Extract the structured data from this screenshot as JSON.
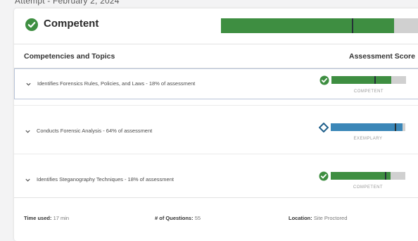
{
  "attempt": {
    "title": "Attempt - February 2, 2024"
  },
  "summary": {
    "status": "Competent",
    "status_color": "#3e8e41",
    "score_fraction": 0.82,
    "marker_fraction": 0.62
  },
  "table": {
    "col_topics": "Competencies and Topics",
    "col_score": "Assessment Score"
  },
  "topics": [
    {
      "label": "Identifies Forensics Rules, Policies, and Laws - 18% of assessment",
      "level": "COMPETENT",
      "icon": "check-circle-icon",
      "color": "#3e8e41",
      "fill": 0.8,
      "marker": 0.58,
      "selected": true
    },
    {
      "label": "Conducts Forensic Analysis - 64% of assessment",
      "level": "EXEMPLARY",
      "icon": "diamond-icon",
      "color": "#3b87b8",
      "fill": 0.96,
      "marker": 0.86,
      "selected": false
    },
    {
      "label": "Identifies Steganography Techniques - 18% of assessment",
      "level": "COMPETENT",
      "icon": "check-circle-icon",
      "color": "#3e8e41",
      "fill": 0.8,
      "marker": 0.73,
      "selected": false
    }
  ],
  "footer": {
    "time_label": "Time used:",
    "time_value": "17 min",
    "questions_label": "# of Questions:",
    "questions_value": "55",
    "location_label": "Location:",
    "location_value": "Site Proctored"
  }
}
